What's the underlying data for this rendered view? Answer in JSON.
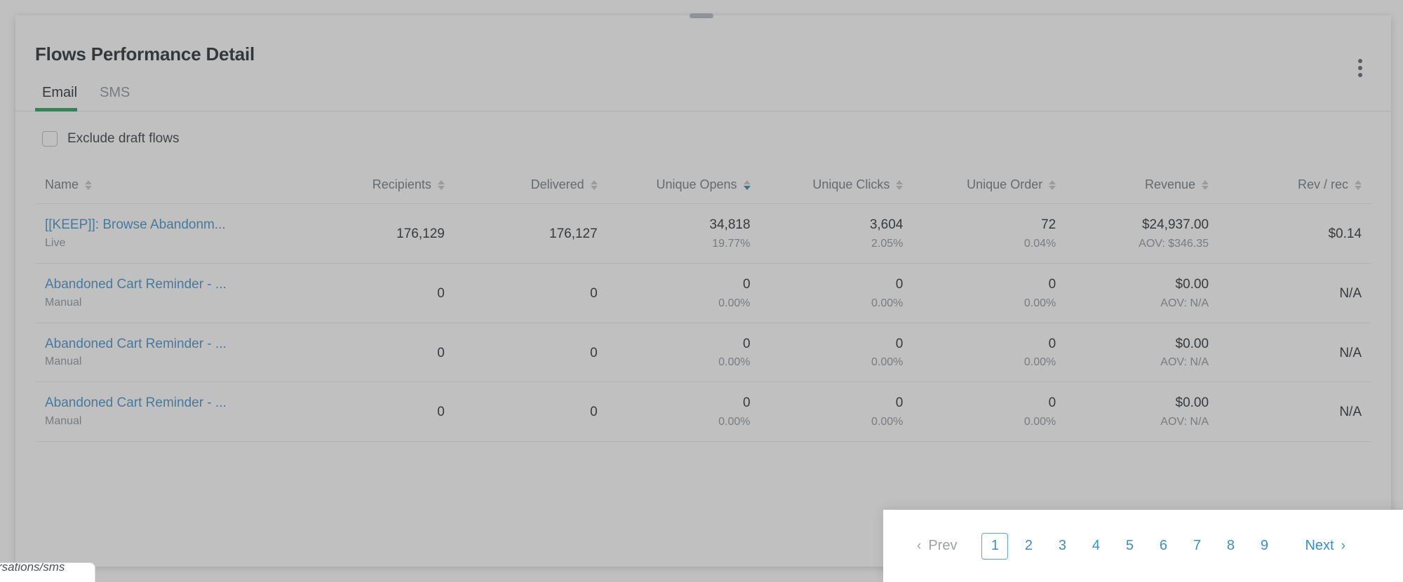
{
  "panel": {
    "title": "Flows Performance Detail",
    "drag_handle": "drag-handle",
    "kebab_label": "More options"
  },
  "tabs": [
    {
      "label": "Email",
      "active": true
    },
    {
      "label": "SMS",
      "active": false
    }
  ],
  "filters": {
    "exclude_draft_label": "Exclude draft flows",
    "exclude_draft_checked": false
  },
  "table": {
    "columns": [
      {
        "label": "Name",
        "align": "left",
        "sort": "none"
      },
      {
        "label": "Recipients",
        "align": "right",
        "sort": "none"
      },
      {
        "label": "Delivered",
        "align": "right",
        "sort": "none"
      },
      {
        "label": "Unique Opens",
        "align": "right",
        "sort": "desc"
      },
      {
        "label": "Unique Clicks",
        "align": "right",
        "sort": "none"
      },
      {
        "label": "Unique Order",
        "align": "right",
        "sort": "none"
      },
      {
        "label": "Revenue",
        "align": "right",
        "sort": "none"
      },
      {
        "label": "Rev / rec",
        "align": "right",
        "sort": "none"
      }
    ],
    "rows": [
      {
        "name": "[[KEEP]]: Browse Abandonm...",
        "status": "Live",
        "recipients": "176,129",
        "delivered": "176,127",
        "unique_opens": "34,818",
        "unique_opens_pct": "19.77%",
        "unique_clicks": "3,604",
        "unique_clicks_pct": "2.05%",
        "unique_order": "72",
        "unique_order_pct": "0.04%",
        "revenue": "$24,937.00",
        "aov": "AOV: $346.35",
        "rev_per_rec": "$0.14"
      },
      {
        "name": "Abandoned Cart Reminder - ...",
        "status": "Manual",
        "recipients": "0",
        "delivered": "0",
        "unique_opens": "0",
        "unique_opens_pct": "0.00%",
        "unique_clicks": "0",
        "unique_clicks_pct": "0.00%",
        "unique_order": "0",
        "unique_order_pct": "0.00%",
        "revenue": "$0.00",
        "aov": "AOV: N/A",
        "rev_per_rec": "N/A"
      },
      {
        "name": "Abandoned Cart Reminder - ...",
        "status": "Manual",
        "recipients": "0",
        "delivered": "0",
        "unique_opens": "0",
        "unique_opens_pct": "0.00%",
        "unique_clicks": "0",
        "unique_clicks_pct": "0.00%",
        "unique_order": "0",
        "unique_order_pct": "0.00%",
        "revenue": "$0.00",
        "aov": "AOV: N/A",
        "rev_per_rec": "N/A"
      },
      {
        "name": "Abandoned Cart Reminder - ...",
        "status": "Manual",
        "recipients": "0",
        "delivered": "0",
        "unique_opens": "0",
        "unique_opens_pct": "0.00%",
        "unique_clicks": "0",
        "unique_clicks_pct": "0.00%",
        "unique_order": "0",
        "unique_order_pct": "0.00%",
        "revenue": "$0.00",
        "aov": "AOV: N/A",
        "rev_per_rec": "N/A"
      }
    ]
  },
  "pagination": {
    "prev_label": "Prev",
    "next_label": "Next",
    "prev_icon": "chevron-left-icon",
    "next_icon": "chevron-right-icon",
    "pages": [
      "1",
      "2",
      "3",
      "4",
      "5",
      "6",
      "7",
      "8",
      "9"
    ],
    "active_page": "1"
  },
  "bottom_chip": {
    "text": "rsations/sms"
  },
  "colors": {
    "accent_green": "#1f9c54",
    "link_blue": "#3b8fc4",
    "sort_active_blue": "#2a7fb8",
    "text_dark": "#1f2529",
    "text_muted": "#8b9197"
  }
}
